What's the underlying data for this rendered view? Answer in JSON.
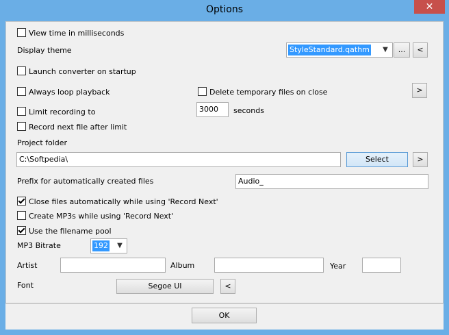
{
  "window": {
    "title": "Options",
    "close_glyph": "✕"
  },
  "options": {
    "view_ms_label": "View time in milliseconds",
    "display_theme_label": "Display theme",
    "theme_value": "StyleStandard.qathm",
    "theme_browse_label": "...",
    "theme_prev_label": "<",
    "launch_converter_label": "Launch converter on startup",
    "always_loop_label": "Always loop playback",
    "delete_temp_label": "Delete temporary files on close",
    "delete_next_label": ">",
    "limit_recording_label": "Limit recording to",
    "limit_value": "3000",
    "seconds_label": "seconds",
    "record_next_label": "Record next file after limit",
    "project_folder_label": "Project folder",
    "project_folder_value": "C:\\Softpedia\\",
    "select_label": "Select",
    "folder_next_label": ">",
    "prefix_label": "Prefix for automatically created files",
    "prefix_value": "Audio_",
    "close_files_label": "Close files automatically while using 'Record Next'",
    "create_mp3_label": "Create MP3s while using 'Record Next'",
    "filename_pool_label": "Use the filename pool",
    "bitrate_label": "MP3 Bitrate",
    "bitrate_value": "192",
    "artist_label": "Artist",
    "artist_value": "",
    "album_label": "Album",
    "album_value": "",
    "year_label": "Year",
    "year_value": "",
    "font_label": "Font",
    "font_value": "Segoe UI",
    "font_prev_label": "<"
  },
  "checkboxes": {
    "view_ms": false,
    "launch_converter": false,
    "always_loop": false,
    "delete_temp": false,
    "limit_recording": false,
    "record_next": false,
    "close_files": true,
    "create_mp3": false,
    "filename_pool": true
  },
  "footer": {
    "ok_label": "OK"
  },
  "colors": {
    "title_bar": "#6aaee6",
    "close_button": "#c7504b",
    "selection": "#3399ff",
    "dialog_bg": "#f0f0f0"
  },
  "icons": {
    "checkbox_checked": "check-icon",
    "dropdown_arrow": "chevron-down-icon"
  }
}
